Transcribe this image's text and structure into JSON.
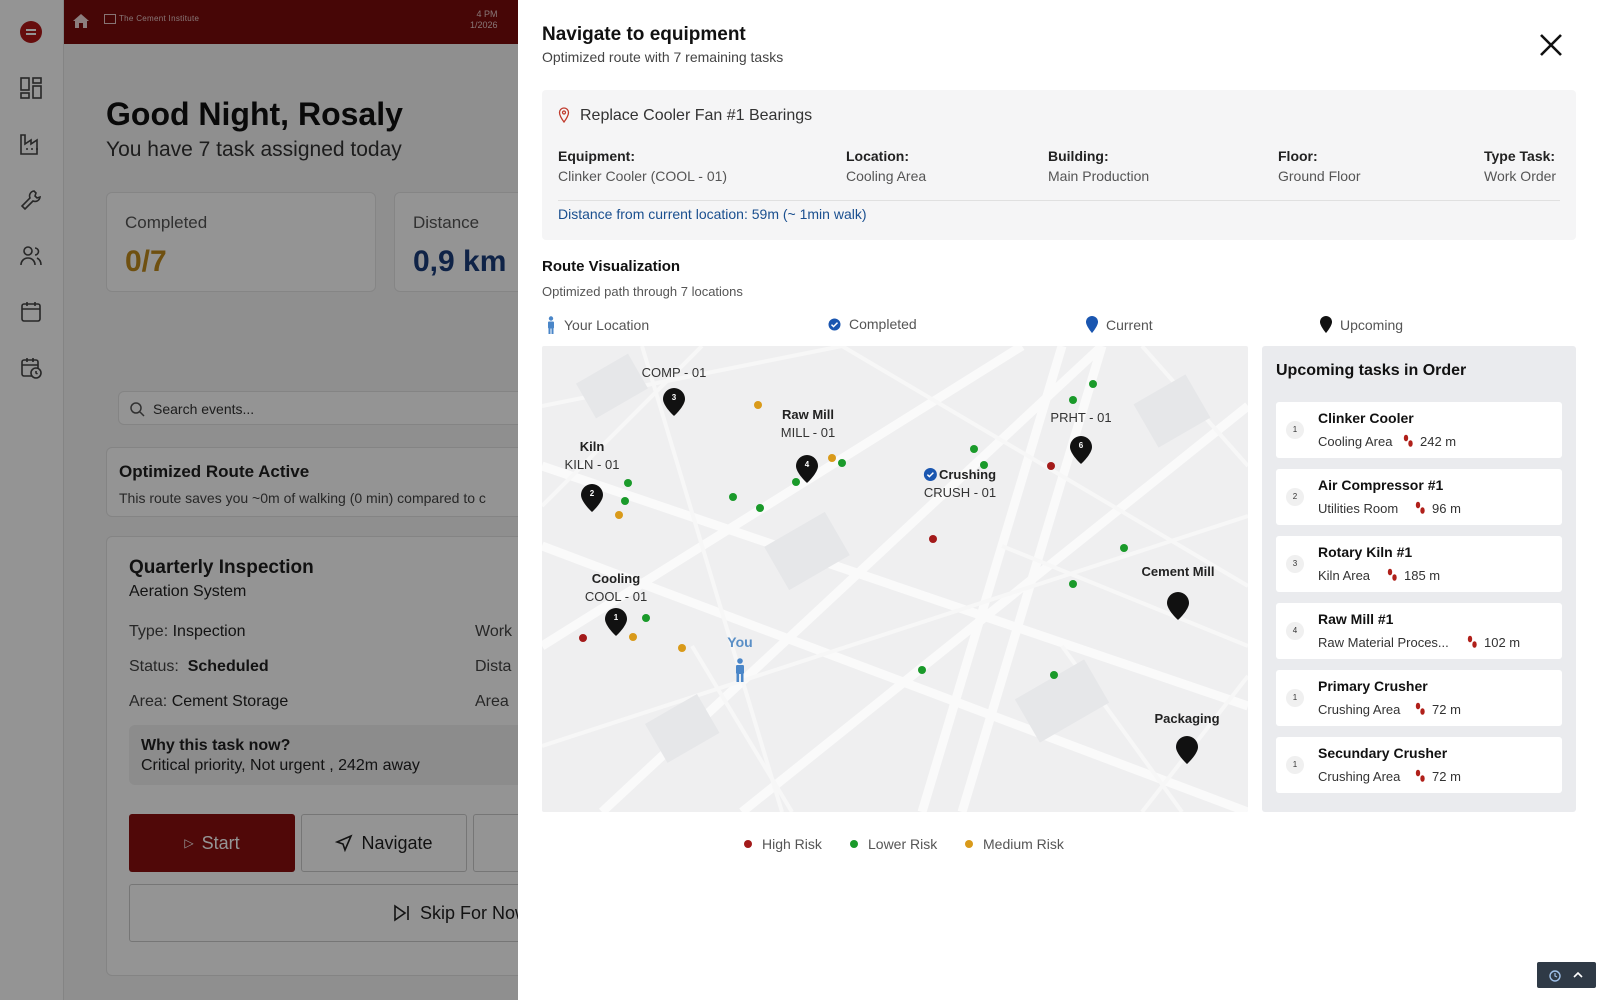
{
  "topbar": {
    "brand": "The Cement Institute",
    "time_line1": "4 PM",
    "time_line2": "1/2026"
  },
  "background": {
    "greeting": "Good Night, Rosaly",
    "greeting_sub": "You have 7 task assigned today",
    "stats": [
      {
        "label": "Completed",
        "value": "0/7",
        "color": "#c08a1c"
      },
      {
        "label": "Distance",
        "value": "0,9 km",
        "color": "#1b3d7a"
      }
    ],
    "search_placeholder": "Search events...",
    "route_card": {
      "title": "Optimized Route Active",
      "desc": "This route saves you ~0m of walking (0 min) compared to c"
    },
    "task": {
      "title": "Quarterly Inspection",
      "subtitle": "Aeration System",
      "type_label": "Type:",
      "type_value": "Inspection",
      "status_label": "Status:",
      "status_value": "Scheduled",
      "area_label": "Area:",
      "area_value": "Cement Storage",
      "right_col1": "Work",
      "right_col2": "Dista",
      "right_col3": "Area",
      "why_title": "Why this task now?",
      "why_text": "Critical priority, Not urgent , 242m away",
      "start_label": "Start",
      "navigate_label": "Navigate",
      "skip_label": "Skip For Now"
    }
  },
  "panel": {
    "title": "Navigate to equipment",
    "subtitle": "Optimized route with 7 remaining tasks",
    "task_name": "Replace Cooler Fan #1 Bearings",
    "fields": [
      {
        "label": "Equipment:",
        "value": "Clinker Cooler (COOL - 01)"
      },
      {
        "label": "Location:",
        "value": "Cooling Area"
      },
      {
        "label": "Building:",
        "value": "Main Production"
      },
      {
        "label": "Floor:",
        "value": "Ground Floor"
      },
      {
        "label": "Type Task:",
        "value": "Work Order"
      }
    ],
    "distance_text": "Distance from current location: 59m (~ 1min walk)",
    "route_title": "Route Visualization",
    "route_sub": "Optimized path through 7 locations",
    "legend_top": [
      "Your Location",
      "Completed",
      "Current",
      "Upcoming"
    ],
    "map_labels": {
      "comp": "COMP - 01",
      "rawmill_name": "Raw Mill",
      "rawmill_code": "MILL - 01",
      "kiln_name": "Kiln",
      "kiln_code": "KILN - 01",
      "prht": "PRHT - 01",
      "crushing_name": "Crushing",
      "crushing_code": "CRUSH - 01",
      "cooling_name": "Cooling",
      "cooling_code": "COOL - 01",
      "cement": "Cement Mill",
      "packaging": "Packaging",
      "you": "You"
    },
    "marker_numbers": {
      "comp": "3",
      "rawmill": "4",
      "kiln": "2",
      "prht": "6",
      "cooling": "1"
    },
    "upcoming_title": "Upcoming tasks in Order",
    "upcoming": [
      {
        "idx": "1",
        "name": "Clinker Cooler",
        "area": "Cooling Area",
        "dist": "242 m"
      },
      {
        "idx": "2",
        "name": "Air Compressor #1",
        "area": "Utilities Room",
        "dist": "96 m"
      },
      {
        "idx": "3",
        "name": "Rotary Kiln #1",
        "area": "Kiln Area",
        "dist": "185 m"
      },
      {
        "idx": "4",
        "name": "Raw Mill #1",
        "area": "Raw Material Proces...",
        "dist": "102 m"
      },
      {
        "idx": "1",
        "name": "Primary Crusher",
        "area": "Crushing Area",
        "dist": "72 m"
      },
      {
        "idx": "1",
        "name": "Secundary Crusher",
        "area": "Crushing Area",
        "dist": "72 m"
      }
    ],
    "legend_bottom": [
      "High Risk",
      "Lower Risk",
      "Medium Risk"
    ],
    "colors": {
      "high": "#a31a1a",
      "lower": "#1a9a2a",
      "medium": "#d99a1a",
      "primary": "#8a0e0e",
      "link": "#1a4f8f"
    }
  }
}
